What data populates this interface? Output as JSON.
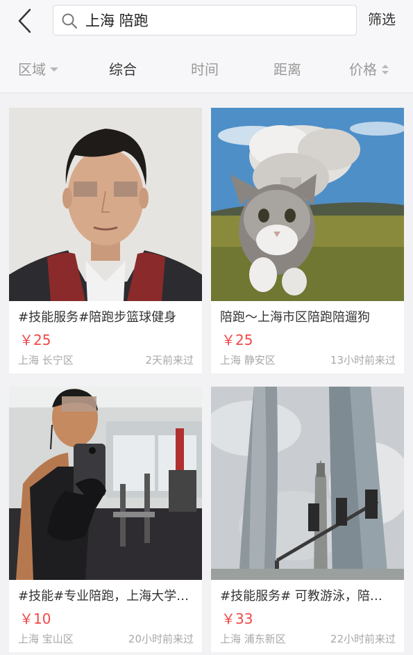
{
  "header": {
    "search_query": "上海 陪跑",
    "filter_label": "筛选"
  },
  "tabs": {
    "region": "区域",
    "overall": "综合",
    "time": "时间",
    "distance": "距离",
    "price": "价格"
  },
  "colors": {
    "price": "#f04848",
    "muted_text": "#a8a8a8",
    "background": "#f2f2f4"
  },
  "listings": [
    {
      "image": "man-portrait-photo",
      "title": "#技能服务#陪跑步篮球健身",
      "price": "￥25",
      "location": "上海  长宁区",
      "time_ago": "2天前来过"
    },
    {
      "image": "cat-walking-photo",
      "title": "陪跑～上海市区陪跑陪遛狗",
      "price": "￥25",
      "location": "上海  静安区",
      "time_ago": "13小时前来过"
    },
    {
      "image": "gym-selfie-photo",
      "title": "#技能#专业陪跑，上海大学…",
      "price": "￥10",
      "location": "上海  宝山区",
      "time_ago": "20小时前来过"
    },
    {
      "image": "shanghai-towers-photo",
      "title": "#技能服务#  可教游泳，陪…",
      "price": "￥33",
      "location": "上海  浦东新区",
      "time_ago": "22小时前来过"
    }
  ]
}
